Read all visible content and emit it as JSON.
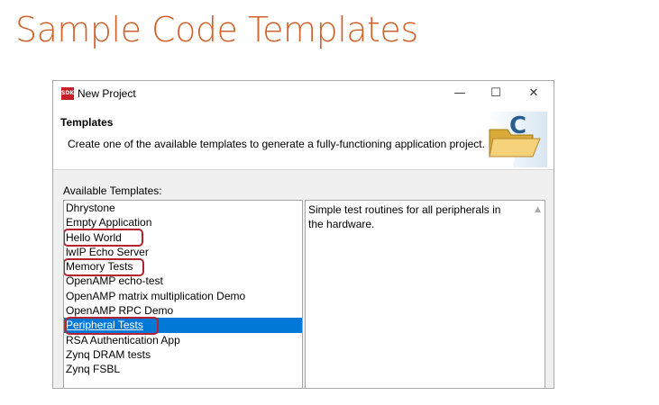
{
  "slide": {
    "title": "Sample Code Templates"
  },
  "window": {
    "app_icon_text": "SDK",
    "title": "New Project",
    "controls": {
      "minimize": "—",
      "maximize": "☐",
      "close": "✕"
    }
  },
  "header": {
    "title": "Templates",
    "description": "Create one of the available templates to generate a fully-functioning application project."
  },
  "templates": {
    "label": "Available Templates:",
    "items": [
      {
        "label": "Dhrystone"
      },
      {
        "label": "Empty Application"
      },
      {
        "label": "Hello World"
      },
      {
        "label": "lwIP Echo Server"
      },
      {
        "label": "Memory Tests"
      },
      {
        "label": "OpenAMP echo-test"
      },
      {
        "label": "OpenAMP matrix multiplication Demo"
      },
      {
        "label": "OpenAMP RPC Demo"
      },
      {
        "label": "Peripheral Tests"
      },
      {
        "label": "RSA Authentication App"
      },
      {
        "label": "Zynq DRAM tests"
      },
      {
        "label": "Zynq FSBL"
      }
    ],
    "selected": "Peripheral Tests"
  },
  "description_panel": {
    "text": "Simple test routines for all peripherals in the hardware."
  },
  "colors": {
    "title_orange": "#d0622a",
    "selection_blue": "#0078d7",
    "callout_red": "#b5232f"
  }
}
